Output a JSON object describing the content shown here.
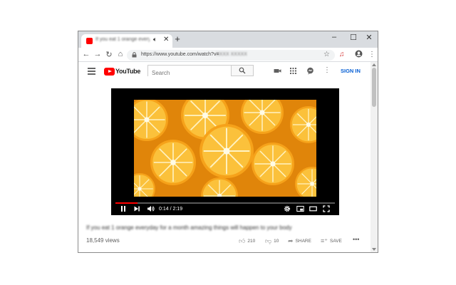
{
  "browser": {
    "tab_title": "If you eat 1 orange everyday",
    "new_tab_label": "+",
    "url_prefix": "https://www.youtube.com/watch?v=",
    "url_blurred": "XXXX XXXXX"
  },
  "youtube": {
    "logo_text": "YouTube",
    "search_placeholder": "Search",
    "sign_in_label": "SIGN IN",
    "player": {
      "time": "0:14 / 2:19",
      "progress": 0.1
    },
    "video_title": "If you eat 1 orange everyday for a month amazing things will happen to your body",
    "views": "18,549 views",
    "likes": "210",
    "dislikes": "10",
    "share_label": "SHARE",
    "save_label": "SAVE"
  },
  "colors": {
    "brand_red": "#ff0000",
    "link_blue": "#065fd4"
  }
}
